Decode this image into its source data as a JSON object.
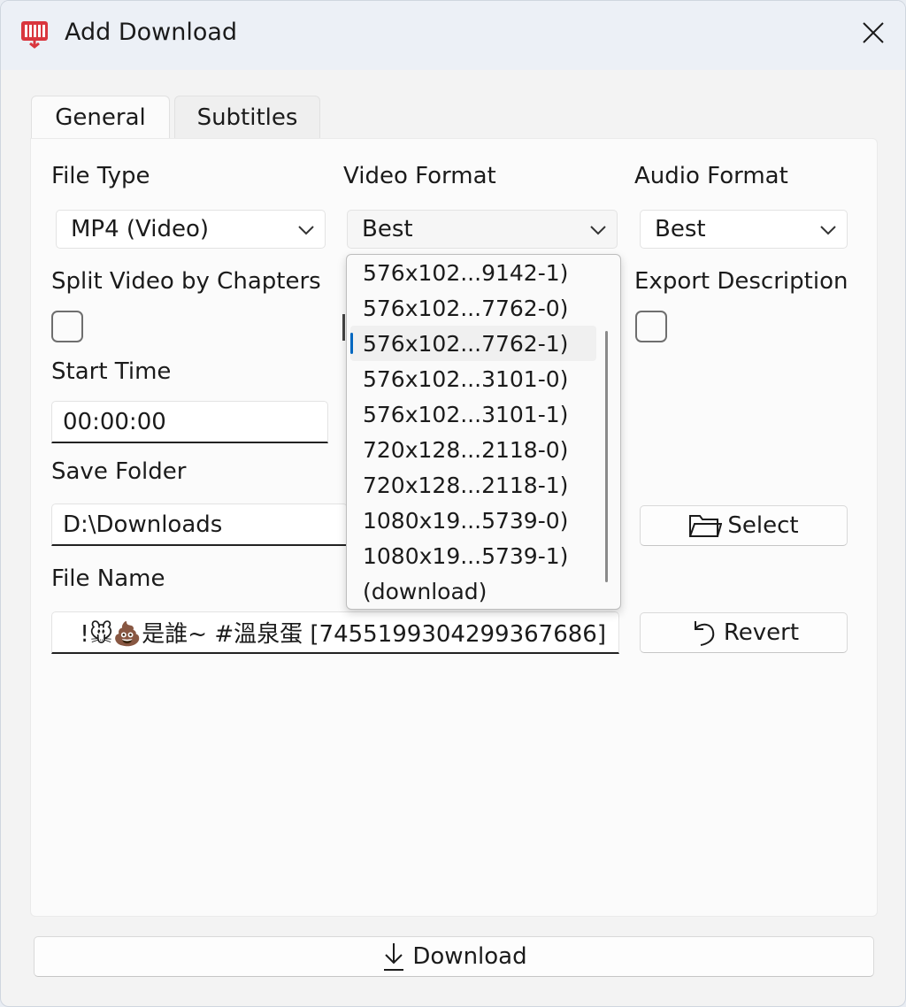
{
  "window": {
    "title": "Add Download"
  },
  "tabs": [
    {
      "label": "General",
      "active": true
    },
    {
      "label": "Subtitles",
      "active": false
    }
  ],
  "general": {
    "file_type": {
      "label": "File Type",
      "value": "MP4 (Video)"
    },
    "video_format": {
      "label": "Video Format",
      "value": "Best",
      "options": [
        "576x102...9142-1)",
        "576x102...7762-0)",
        "576x102...7762-1)",
        "576x102...3101-0)",
        "576x102...3101-1)",
        "720x128...2118-0)",
        "720x128...2118-1)",
        "1080x19...5739-0)",
        "1080x19...5739-1)",
        "(download)"
      ],
      "highlighted_index": 2
    },
    "audio_format": {
      "label": "Audio Format",
      "value": "Best"
    },
    "split_chapters": {
      "label": "Split Video by Chapters",
      "checked": false
    },
    "export_description": {
      "label": "Export Description",
      "checked": false
    },
    "start_time": {
      "label": "Start Time",
      "value": "00:00:00"
    },
    "save_folder": {
      "label": "Save Folder",
      "value": "D:\\Downloads",
      "button": "Select"
    },
    "file_name": {
      "label": "File Name",
      "value": "!🐭💩是誰~ #溫泉蛋 [7455199304299367686]",
      "button": "Revert"
    }
  },
  "footer": {
    "download_label": "Download"
  },
  "colors": {
    "accent": "#0067c0",
    "app_icon": "#d9363e"
  }
}
